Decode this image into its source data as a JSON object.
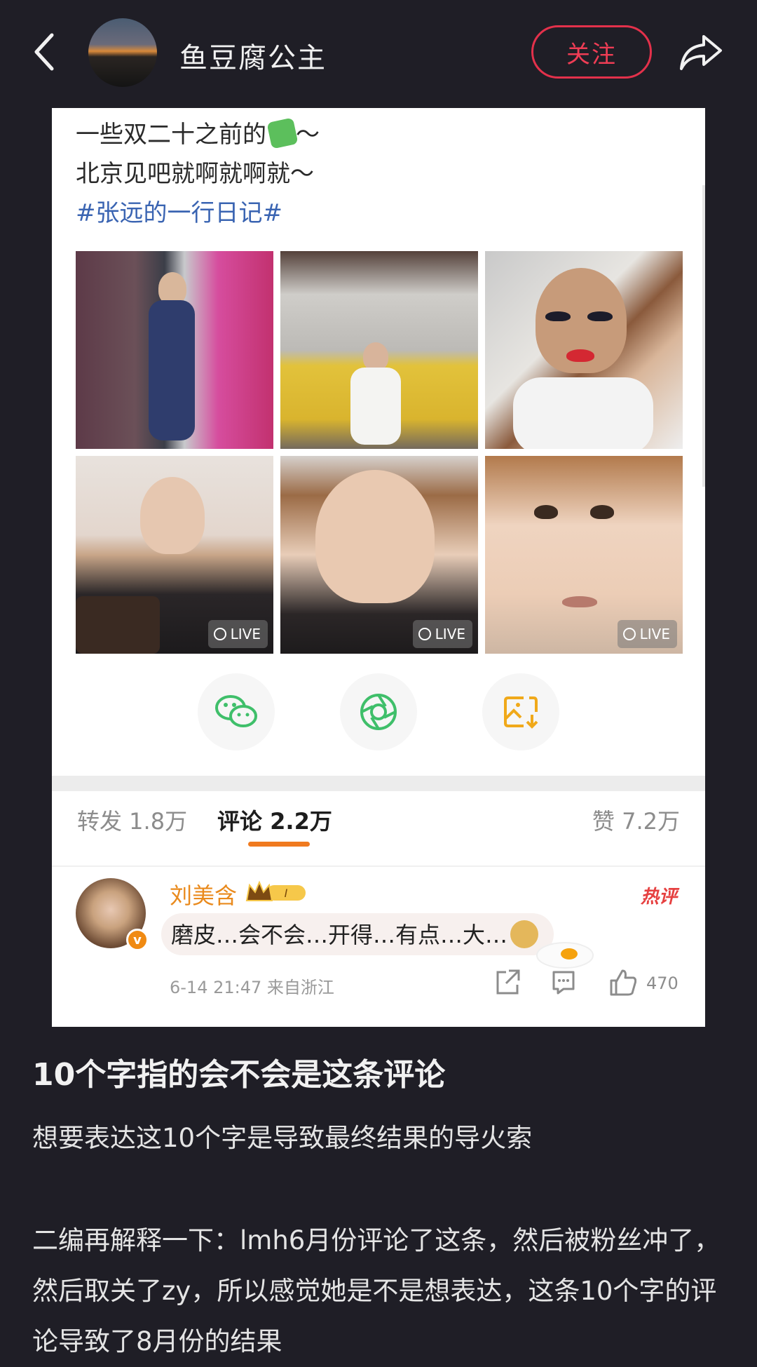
{
  "header": {
    "username": "鱼豆腐公主",
    "follow_label": "关注"
  },
  "post": {
    "lines": [
      "一些双二十之前的",
      "北京见吧就啊就啊就～"
    ],
    "line1_suffix": "～",
    "hashtag": "#张远的一行日记#",
    "live_label": "LIVE"
  },
  "stats": {
    "repost": "转发 1.8万",
    "comment": "评论 2.2万",
    "like": "赞 7.2万"
  },
  "comment": {
    "name": "刘美含",
    "badge_level": "I",
    "hot_tag": "热评",
    "text": "磨皮…会不会…开得…有点…大…",
    "meta": "6-14 21:47  来自浙江",
    "like_count": "470"
  },
  "article": {
    "title": "10个字指的会不会是这条评论",
    "p1": "想要表达这10个字是导致最终结果的导火索",
    "p2": "二编再解释一下：lmh6月份评论了这条，然后被粉丝冲了，然后取关了zy，所以感觉她是不是想表达，这条10个字的评论导致了8月份的结果"
  },
  "colors": {
    "page_bg": "#1f1e26",
    "follow_red": "#e3314b",
    "hashtag_blue": "#3a64b2",
    "accent_orange": "#f07a1f",
    "wechat_green": "#3fbf6a"
  },
  "icons": [
    "back-chevron-icon",
    "share-arrow-icon",
    "puzzle-emoji-icon",
    "wechat-icon",
    "moments-icon",
    "save-image-icon",
    "crown-badge-icon",
    "doge-emoji-icon",
    "fried-egg-sticker",
    "share-icon",
    "comment-icon",
    "thumbs-up-icon"
  ]
}
